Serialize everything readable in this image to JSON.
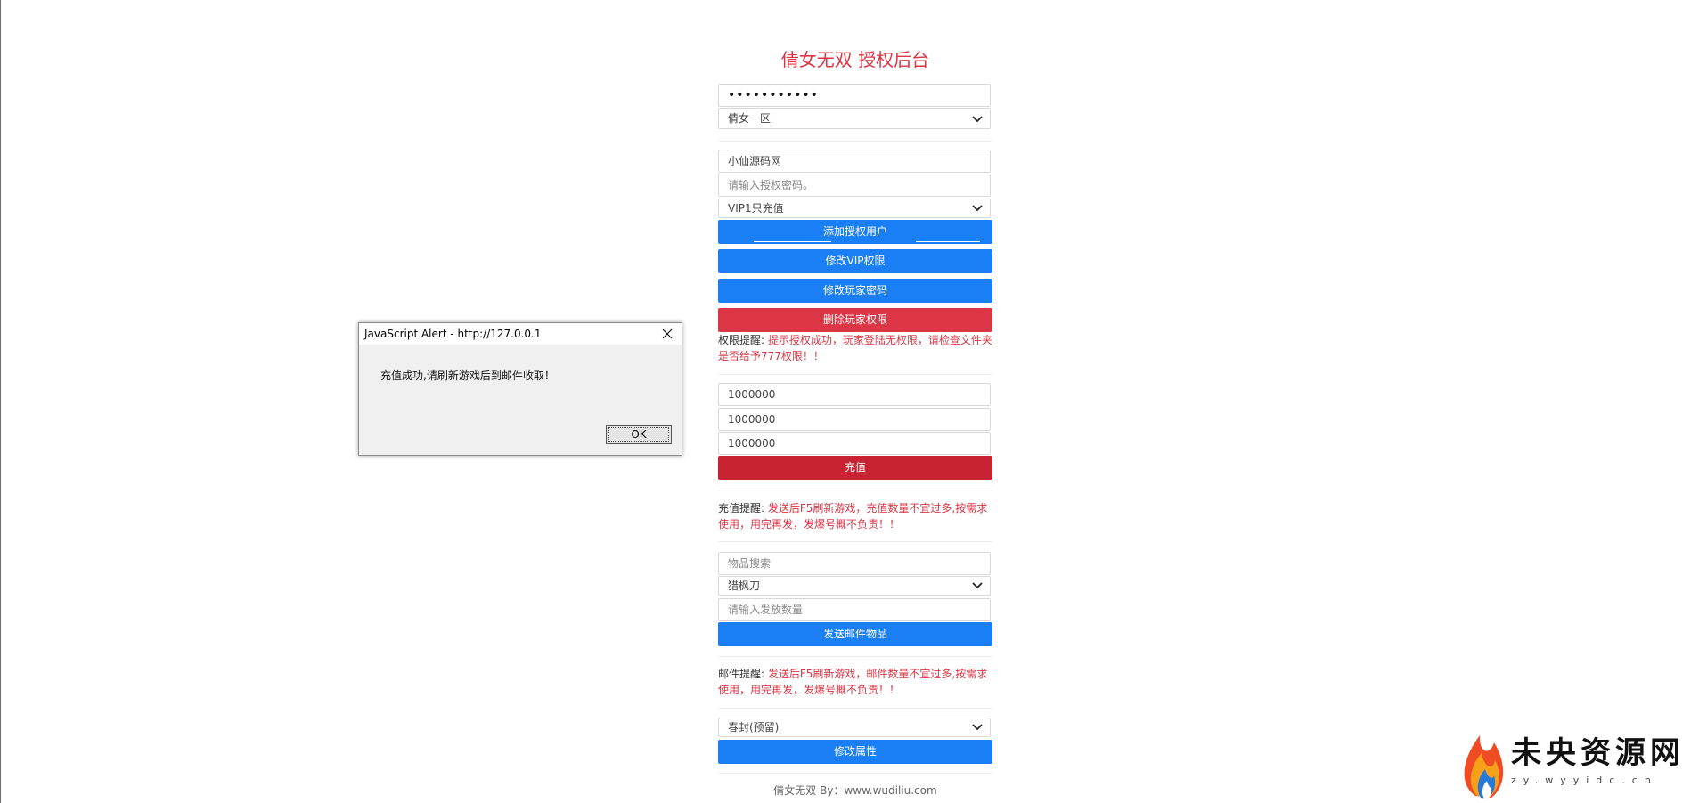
{
  "header": {
    "title": "倩女无双 授权后台"
  },
  "login": {
    "password_value": "•••••••••••",
    "server_selected": "倩女一区"
  },
  "authorization": {
    "username_value": "小仙源码网",
    "password_placeholder": "请输入授权密码。",
    "vip_selected": "VIP1只充值",
    "add_button": "添加授权用户",
    "modify_vip_button": "修改VIP权限",
    "modify_password_button": "修改玩家密码",
    "delete_button": "删除玩家权限",
    "notice_label": "权限提醒: ",
    "notice_text": "提示授权成功，玩家登陆无权限，请检查文件夹是否给予777权限！！"
  },
  "recharge": {
    "field1_value": "1000000",
    "field2_value": "1000000",
    "field3_value": "1000000",
    "button": "充值",
    "notice_label": "充值提醒: ",
    "notice_text": "发送后F5刷新游戏，充值数量不宜过多,按需求使用，用完再发，发爆号概不负责！！"
  },
  "mail": {
    "search_placeholder": "物品搜索",
    "item_selected": "猎枫刀",
    "quantity_placeholder": "请输入发放数量",
    "button": "发送邮件物品",
    "notice_label": "邮件提醒: ",
    "notice_text": "发送后F5刷新游戏，邮件数量不宜过多,按需求使用，用完再发，发爆号概不负责！！"
  },
  "attribute": {
    "selected": "春封(预留)",
    "button": "修改属性"
  },
  "footer": {
    "text": "倩女无双 By：www.wudiliu.com"
  },
  "dialog": {
    "title": "JavaScript Alert - http://127.0.0.1",
    "message": "充值成功,请刷新游戏后到邮件收取！",
    "ok_label": "OK",
    "close_icon": "close-icon"
  },
  "watermark": {
    "text": "未央资源网",
    "subtext": "zy.wyyidc.cn",
    "logo_icon": "flame-logo-icon"
  },
  "colors": {
    "primary_blue": "#1a7ff5",
    "danger_red": "#dc3545",
    "dark_red": "#c82333"
  }
}
